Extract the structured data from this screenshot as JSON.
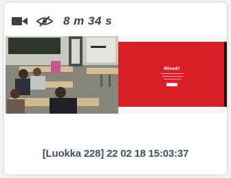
{
  "recording": {
    "duration": "8 m 34 s",
    "caption": "[Luokka 228] 22 02 18 15:03:37"
  },
  "icons": {
    "camera": "video-camera-icon",
    "visibility": "eye-slash-icon"
  },
  "thumbnails": {
    "left": "classroom-camera-view",
    "right": "presentation-screen-view"
  },
  "slide": {
    "title": "Mixed?"
  },
  "colors": {
    "text_dark": "#3b3f4a",
    "caption_blue": "#3a4f6b",
    "slide_red": "#d81f26"
  }
}
